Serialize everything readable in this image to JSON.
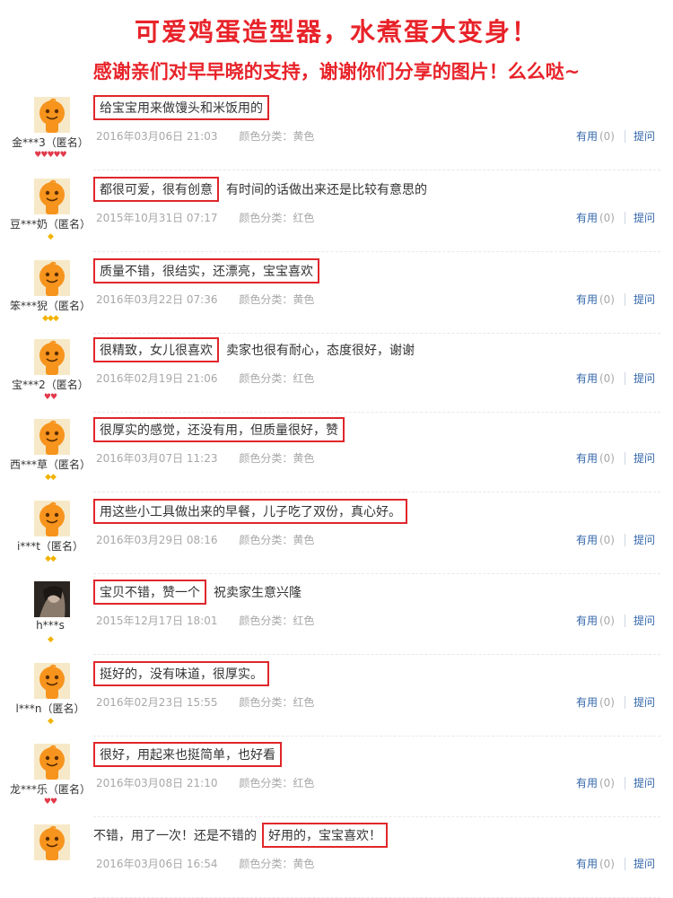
{
  "banner": {
    "line1": "可爱鸡蛋造型器，水煮蛋大变身！",
    "line2": "感谢亲们对早早晓的支持，谢谢你们分享的图片！么么哒~"
  },
  "labels": {
    "useful": "有用",
    "ask": "提问",
    "color_prefix": "颜色分类："
  },
  "reviews": [
    {
      "user": "金***3（匿名）",
      "highlight": "给宝宝用来做馒头和米饭用的",
      "tail": "",
      "date": "2016年03月06日 21:03",
      "color": "黄色",
      "useful": "(0)",
      "avatar": "default",
      "level": {
        "kind": "red",
        "count": 5
      }
    },
    {
      "user": "豆***奶（匿名）",
      "highlight": "都很可爱，很有创意",
      "tail": "有时间的话做出来还是比较有意思的",
      "date": "2015年10月31日 07:17",
      "color": "红色",
      "useful": "(0)",
      "avatar": "default",
      "level": {
        "kind": "gold",
        "count": 1
      }
    },
    {
      "user": "笨***猊（匿名）",
      "highlight": "质量不错，很结实，还漂亮，宝宝喜欢",
      "tail": "",
      "date": "2016年03月22日 07:36",
      "color": "黄色",
      "useful": "(0)",
      "avatar": "default",
      "level": {
        "kind": "gold",
        "count": 3
      }
    },
    {
      "user": "宝***2（匿名）",
      "highlight": "很精致，女儿很喜欢",
      "tail": "卖家也很有耐心，态度很好，谢谢",
      "date": "2016年02月19日 21:06",
      "color": "红色",
      "useful": "(0)",
      "avatar": "default",
      "level": {
        "kind": "red",
        "count": 2
      }
    },
    {
      "user": "西***草（匿名）",
      "highlight": "很厚实的感觉，还没有用，但质量很好，赞",
      "tail": "",
      "date": "2016年03月07日 11:23",
      "color": "黄色",
      "useful": "(0)",
      "avatar": "default",
      "level": {
        "kind": "gold",
        "count": 2
      }
    },
    {
      "user": "i***t（匿名）",
      "highlight": "用这些小工具做出来的早餐，儿子吃了双份，真心好。",
      "tail": "",
      "date": "2016年03月29日 08:16",
      "color": "黄色",
      "useful": "(0)",
      "avatar": "default",
      "level": {
        "kind": "gold",
        "count": 2
      }
    },
    {
      "user": "h***s",
      "highlight": "宝贝不错，赞一个",
      "tail": "祝卖家生意兴隆",
      "date": "2015年12月17日 18:01",
      "color": "红色",
      "useful": "(0)",
      "avatar": "photo",
      "level": {
        "kind": "gold",
        "count": 1
      }
    },
    {
      "user": "l***n（匿名）",
      "highlight": "挺好的，没有味道，很厚实。",
      "tail": "",
      "date": "2016年02月23日 15:55",
      "color": "红色",
      "useful": "(0)",
      "avatar": "default",
      "level": {
        "kind": "gold",
        "count": 1
      }
    },
    {
      "user": "龙***乐（匿名）",
      "highlight": "很好，用起来也挺简单，也好看",
      "tail": "",
      "date": "2016年03月08日 21:10",
      "color": "红色",
      "useful": "(0)",
      "avatar": "default",
      "level": {
        "kind": "red",
        "count": 2
      }
    },
    {
      "user": "",
      "prefix": "不错，用了一次！还是不错的",
      "highlight": "好用的，宝宝喜欢！",
      "tail": "",
      "date": "2016年03月06日 16:54",
      "color": "黄色",
      "useful": "(0)",
      "avatar": "default",
      "level": {
        "kind": "gold",
        "count": 0
      }
    }
  ]
}
